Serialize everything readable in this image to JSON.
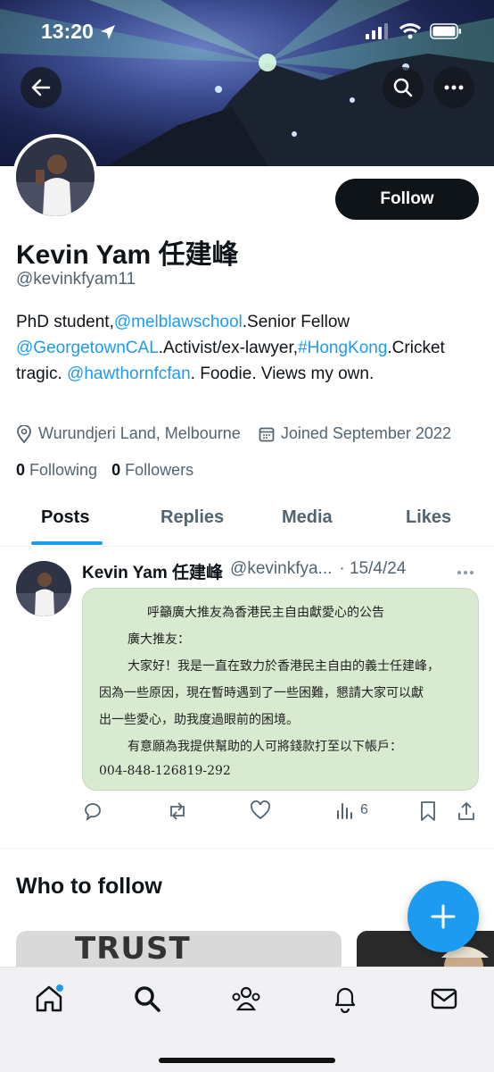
{
  "status_bar": {
    "time": "13:20"
  },
  "profile": {
    "follow_label": "Follow",
    "name": "Kevin Yam 任建峰",
    "handle": "@kevinkfyam11",
    "bio": {
      "p1": "PhD student,",
      "l1": "@melblawschool",
      "p2": ".Senior Fellow",
      "l2": "@GeorgetownCAL",
      "p3": ".Activist/ex-lawyer,",
      "l3": "#HongKong",
      "p4": ".Cricket tragic. ",
      "l4": "@hawthornfcfan",
      "p5": ". Foodie. Views my own."
    },
    "location": "Wurundjeri Land, Melbourne",
    "joined": "Joined September 2022",
    "following_count": "0",
    "following_label": "Following",
    "followers_count": "0",
    "followers_label": "Followers"
  },
  "tabs": [
    "Posts",
    "Replies",
    "Media",
    "Likes"
  ],
  "tweet": {
    "name": "Kevin Yam 任建峰",
    "handle": "@kevinkfya...",
    "date": "· 15/4/24",
    "image_lines": [
      "呼籲廣大推友為香港民主自由獻愛心的公告",
      "廣大推友：",
      "大家好！我是一直在致力於香港民主自由的義士任建峰，",
      "因為一些原因，現在暫時遇到了一些困難，懇請大家可以獻",
      "出一些愛心，助我度過眼前的困境。",
      "有意願為我提供幫助的人可將錢款打至以下帳戶：",
      "004-848-126819-292"
    ],
    "views": "6"
  },
  "who_to_follow": {
    "title": "Who to follow",
    "card1_text": "TRUST WOMEN."
  },
  "colors": {
    "accent": "#1d9bf0",
    "text": "#0f1419",
    "muted": "#536471"
  }
}
